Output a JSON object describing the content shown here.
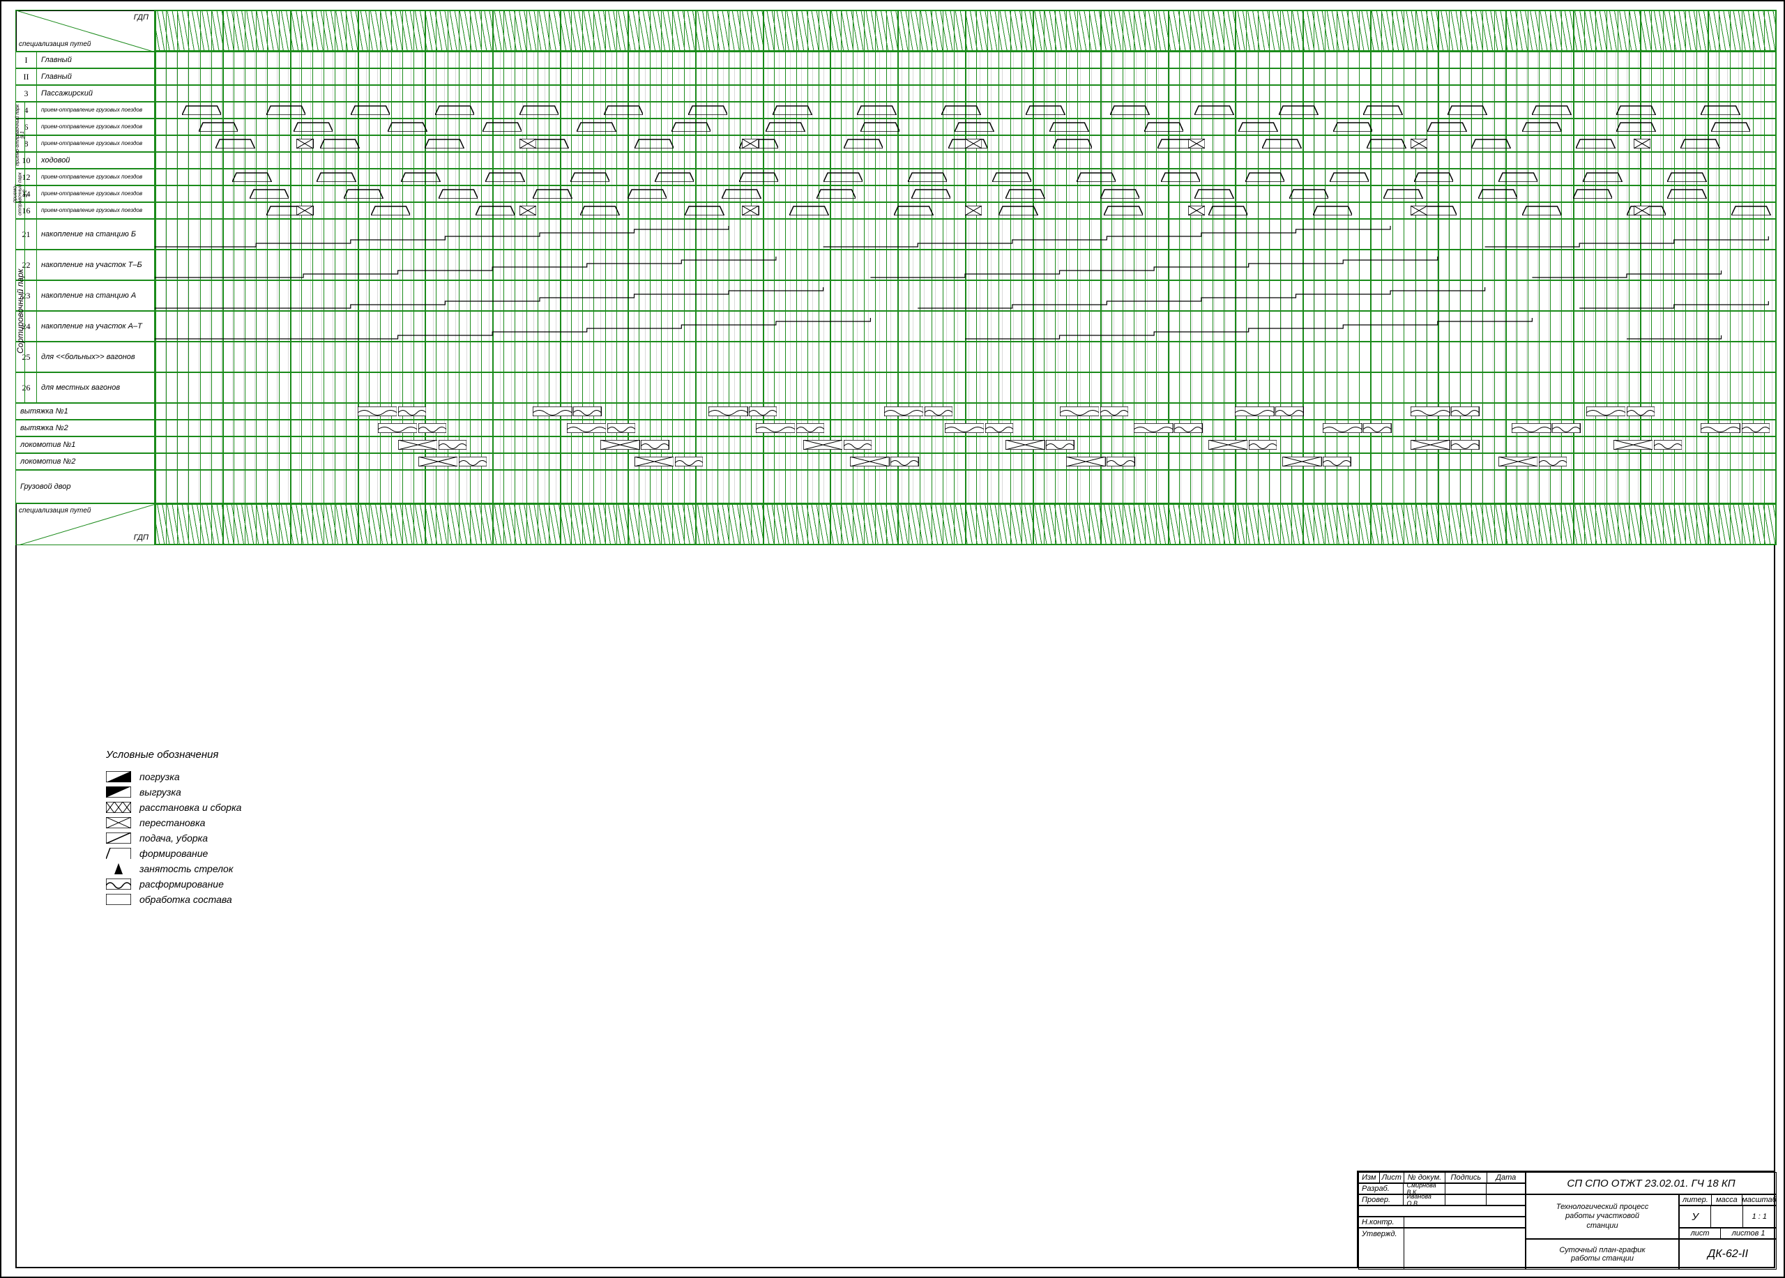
{
  "sheet": {
    "gdp_label": "ГДП",
    "spec_label": "специализация путей"
  },
  "tracks": [
    {
      "num": "I",
      "label": "Главный",
      "h": 24
    },
    {
      "num": "II",
      "label": "Главный",
      "h": 24
    },
    {
      "num": "3",
      "label": "Пассажирский",
      "h": 24
    },
    {
      "num": "4",
      "label": "прием-отправление грузовых поездов",
      "h": 24,
      "small": true
    },
    {
      "num": "6",
      "label": "прием-отправление грузовых поездов",
      "h": 24,
      "small": true
    },
    {
      "num": "8",
      "label": "прием-отправление грузовых поездов",
      "h": 24,
      "small": true
    },
    {
      "num": "10",
      "label": "ходовой",
      "h": 24
    },
    {
      "num": "12",
      "label": "прием-отправление грузовых поездов",
      "h": 24,
      "small": true
    },
    {
      "num": "14",
      "label": "прием-отправление грузовых поездов",
      "h": 24,
      "small": true
    },
    {
      "num": "16",
      "label": "прием-отправление грузовых поездов",
      "h": 24,
      "small": true
    },
    {
      "num": "21",
      "label": "накопление на станцию Б",
      "h": 44
    },
    {
      "num": "22",
      "label": "накопление на участок Т–Б",
      "h": 44
    },
    {
      "num": "23",
      "label": "накопление на станцию А",
      "h": 44
    },
    {
      "num": "24",
      "label": "накопление на участок А–Т",
      "h": 44
    },
    {
      "num": "25",
      "label": "для <<больных>> вагонов",
      "h": 44
    },
    {
      "num": "26",
      "label": "для местных вагонов",
      "h": 44
    },
    {
      "num": "",
      "label": "вытяжка №1",
      "h": 24,
      "nonum": true
    },
    {
      "num": "",
      "label": "вытяжка №2",
      "h": 24,
      "nonum": true
    },
    {
      "num": "",
      "label": "локомотив №1",
      "h": 24,
      "nonum": true
    },
    {
      "num": "",
      "label": "локомотив №2",
      "h": 24,
      "nonum": true
    },
    {
      "num": "",
      "label": "Грузовой двор",
      "h": 48,
      "nonum": true
    }
  ],
  "groups": [
    {
      "label": "приемо-отправочный парк №1",
      "from": 3,
      "to": 6
    },
    {
      "label": "приемо-отправочный парк №2",
      "from": 7,
      "to": 9
    },
    {
      "label": "Сортировочный парк",
      "from": 10,
      "to": 15
    }
  ],
  "legend": {
    "title": "Условные обозначения",
    "items": [
      {
        "key": "load",
        "label": "погрузка"
      },
      {
        "key": "unload",
        "label": "выгрузка"
      },
      {
        "key": "place",
        "label": "расстановка и сборка"
      },
      {
        "key": "move",
        "label": "перестановка"
      },
      {
        "key": "deliver",
        "label": "подача, уборка"
      },
      {
        "key": "form",
        "label": "формирование"
      },
      {
        "key": "switch",
        "label": "занятость стрелок"
      },
      {
        "key": "deform",
        "label": "расформирование"
      },
      {
        "key": "process",
        "label": "обработка состава"
      }
    ]
  },
  "title_block": {
    "code": "СП СПО ОТЖТ 23.02.01. ГЧ 18 КП",
    "subtitle1": "Технологический процесс",
    "subtitle2": "работы участковой",
    "subtitle3": "станции",
    "drawing": "Суточный план-график",
    "drawing2": "работы станции",
    "sheet_code": "ДК-62-II",
    "u_label": "У",
    "scale": "1 : 1",
    "lithera": "литер.",
    "mass": "масса",
    "scale_hdr": "масштаб",
    "list": "лист",
    "listov": "листов     1",
    "roles": {
      "izm": "Изм",
      "list_h": "Лист",
      "ndoc": "№ докум.",
      "podp": "Подпись",
      "data": "Дата",
      "razrab": "Разраб.",
      "name1": "Смирнова В.К.",
      "prover": "Провер.",
      "name2": "Иванова О.В.",
      "nkontr": "Н.контр.",
      "utverd": "Утвержд."
    }
  },
  "hours": 24
}
